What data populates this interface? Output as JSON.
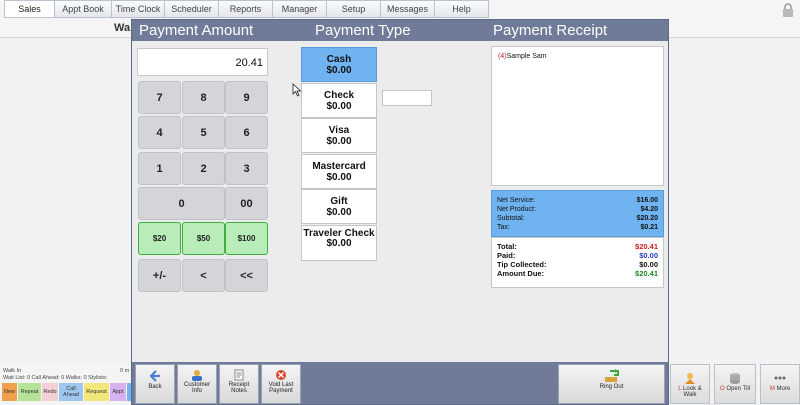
{
  "nav": {
    "tabs": [
      "Sales",
      "Appt Book",
      "Time Clock",
      "Scheduler",
      "Reports",
      "Manager",
      "Setup",
      "Messages",
      "Help"
    ],
    "active_tab": "Sales"
  },
  "behind": {
    "title_fragment": "Wa"
  },
  "modal": {
    "headers": {
      "amount": "Payment Amount",
      "type": "Payment Type",
      "receipt": "Payment Receipt"
    },
    "amount_value": "20.41",
    "keypad": [
      "7",
      "8",
      "9",
      "4",
      "5",
      "6",
      "1",
      "2",
      "3",
      "0",
      "00",
      "$20",
      "$50",
      "$100",
      "+/-",
      "<",
      "<<"
    ],
    "payment_types": [
      {
        "name": "Cash",
        "amount": "$0.00",
        "selected": true
      },
      {
        "name": "Check",
        "amount": "$0.00"
      },
      {
        "name": "Visa",
        "amount": "$0.00"
      },
      {
        "name": "Mastercard",
        "amount": "$0.00"
      },
      {
        "name": "Gift",
        "amount": "$0.00"
      },
      {
        "name": "Traveler Check",
        "amount": "$0.00"
      }
    ],
    "receipt": {
      "line_num": "(4)",
      "line_name": "Sample Sam"
    },
    "summary": {
      "net_service_label": "Net Service:",
      "net_service": "$16.00",
      "net_product_label": "Net Product:",
      "net_product": "$4.20",
      "subtotal_label": "Subtotal:",
      "subtotal": "$20.20",
      "tax_label": "Tax:",
      "tax": "$0.21",
      "total_label": "Total:",
      "total": "$20.41",
      "paid_label": "Paid:",
      "paid": "$0.00",
      "tip_label": "Tip Collected:",
      "tip": "$0.00",
      "due_label": "Amount Due:",
      "due": "$20.41"
    },
    "footer": {
      "back": "Back",
      "customer_info_1": "Customer",
      "customer_info_2": "Info",
      "receipt_notes_1": "Receipt",
      "receipt_notes_2": "Notes",
      "void_1": "Void Last",
      "void_2": "Payment",
      "ring_out": "Ring Out"
    }
  },
  "walkin": {
    "title": "Walk In",
    "stats": "Wait List: 0   Call Ahead: 0   Walks: 0   Stylists:",
    "right": "0 m",
    "chips": [
      "New",
      "Repeat",
      "Redo",
      "Call Ahead",
      "Request",
      "Appt"
    ]
  },
  "right_buttons": {
    "look_walk": "Look & Walk",
    "look_key": "L",
    "open_till": "Open Till",
    "open_key": "O",
    "more": "More",
    "more_key": "M"
  },
  "colors": {
    "header": "#6f7b99",
    "selected": "#6fb3f0",
    "money_key": "#b8ecb8"
  }
}
